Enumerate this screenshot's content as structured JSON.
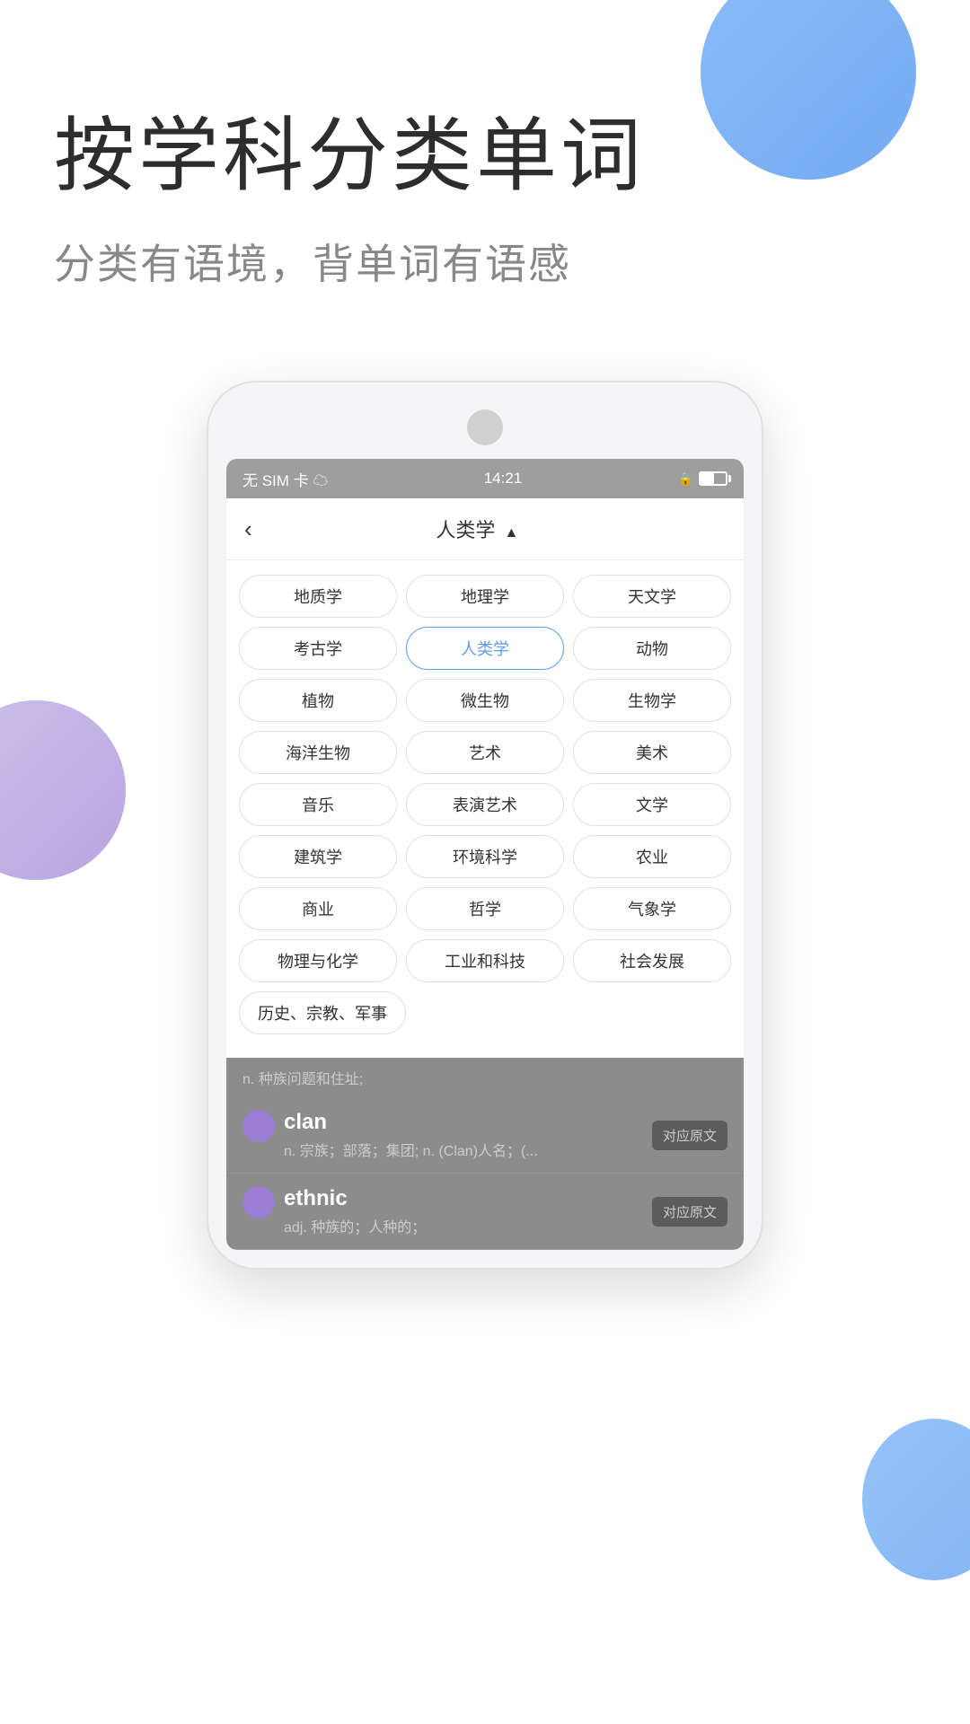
{
  "hero": {
    "title": "按学科分类单词",
    "subtitle": "分类有语境，背单词有语感"
  },
  "status_bar": {
    "left": "无 SIM 卡 ☁",
    "time": "14:21",
    "signal": "🔒"
  },
  "navbar": {
    "back": "‹",
    "title": "人类学",
    "arrow": "▲"
  },
  "categories": [
    [
      "地质学",
      "地理学",
      "天文学"
    ],
    [
      "考古学",
      "人类学",
      "动物"
    ],
    [
      "植物",
      "微生物",
      "生物学"
    ],
    [
      "海洋生物",
      "艺术",
      "美术"
    ],
    [
      "音乐",
      "表演艺术",
      "文学"
    ],
    [
      "建筑学",
      "环境科学",
      "农业"
    ],
    [
      "商业",
      "哲学",
      "气象学"
    ],
    [
      "物理与化学",
      "工业和科技",
      "社会发展"
    ],
    [
      "历史、宗教、军事"
    ]
  ],
  "active_category": "人类学",
  "word_list_header": "n. 种族问题和住址;",
  "words": [
    {
      "english": "clan",
      "chinese": "n. 宗族；部落；集团; n. (Clan)人名；(...",
      "action": "对应原文"
    },
    {
      "english": "ethnic",
      "chinese": "adj. 种族的；人种的；",
      "action": "对应原文"
    }
  ],
  "decorative": {
    "circle_top_color": "#74b0f5",
    "circle_left_color": "#9b7ed4",
    "circle_right_color": "#74b0f5"
  }
}
